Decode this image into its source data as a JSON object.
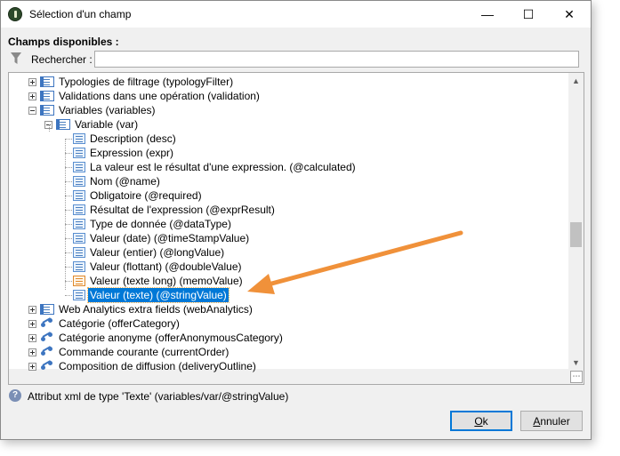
{
  "window": {
    "title": "Sélection d'un champ"
  },
  "title_buttons": {
    "minimize": "—",
    "maximize": "☐",
    "close": "✕"
  },
  "available_fields_label": "Champs disponibles :",
  "search": {
    "label": "Rechercher :",
    "value": ""
  },
  "tree": {
    "items": [
      {
        "label": "Typologies de filtrage (typologyFilter)",
        "expander": "plus",
        "icon": "node-icon"
      },
      {
        "label": "Validations dans une opération (validation)",
        "expander": "plus",
        "icon": "node-icon"
      },
      {
        "label": "Variables (variables)",
        "expander": "minus",
        "icon": "node-icon"
      },
      {
        "label": "Variable (var)",
        "expander": "minus",
        "icon": "node-icon"
      },
      {
        "label": "Description (desc)",
        "icon": "field-icon"
      },
      {
        "label": "Expression (expr)",
        "icon": "field-icon"
      },
      {
        "label": "La valeur est le résultat d'une expression. (@calculated)",
        "icon": "field-icon"
      },
      {
        "label": "Nom (@name)",
        "icon": "field-icon"
      },
      {
        "label": "Obligatoire (@required)",
        "icon": "field-icon"
      },
      {
        "label": "Résultat de l'expression (@exprResult)",
        "icon": "field-icon"
      },
      {
        "label": "Type de donnée (@dataType)",
        "icon": "field-icon"
      },
      {
        "label": "Valeur (date) (@timeStampValue)",
        "icon": "field-icon"
      },
      {
        "label": "Valeur (entier) (@longValue)",
        "icon": "field-icon"
      },
      {
        "label": "Valeur (flottant) (@doubleValue)",
        "icon": "field-icon"
      },
      {
        "label": "Valeur (texte long) (memoValue)",
        "icon": "memo-field-icon"
      },
      {
        "label": "Valeur (texte) (@stringValue)",
        "icon": "field-icon",
        "selected": true
      },
      {
        "label": "Web Analytics extra fields (webAnalytics)",
        "expander": "plus",
        "icon": "node-icon"
      },
      {
        "label": "Catégorie (offerCategory)",
        "expander": "plus",
        "icon": "link-icon"
      },
      {
        "label": "Catégorie anonyme (offerAnonymousCategory)",
        "expander": "plus",
        "icon": "link-icon"
      },
      {
        "label": "Commande courante (currentOrder)",
        "expander": "plus",
        "icon": "link-icon"
      },
      {
        "label": "Composition de diffusion (deliveryOutline)",
        "expander": "plus",
        "icon": "link-icon"
      }
    ]
  },
  "status": {
    "text": "Attribut xml de type 'Texte' (variables/var/@stringValue)"
  },
  "buttons": {
    "ok": {
      "underlined": "O",
      "rest": "k"
    },
    "cancel": {
      "underlined": "A",
      "rest": "nnuler"
    }
  },
  "annotation": {
    "arrow_color": "#f0913a"
  }
}
